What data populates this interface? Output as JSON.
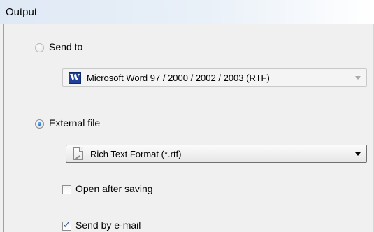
{
  "header": {
    "title": "Output"
  },
  "send_to": {
    "label": "Send to",
    "selected": false,
    "combo": {
      "value": "Microsoft Word 97 / 2000 / 2002 / 2003 (RTF)",
      "enabled": false
    }
  },
  "external_file": {
    "label": "External file",
    "selected": true,
    "combo": {
      "value": "Rich Text Format (*.rtf)",
      "enabled": true
    }
  },
  "open_after_saving": {
    "label": "Open after saving",
    "checked": false
  },
  "send_by_email": {
    "label": "Send by e-mail",
    "checked": true
  },
  "icons": {
    "word": "W"
  }
}
